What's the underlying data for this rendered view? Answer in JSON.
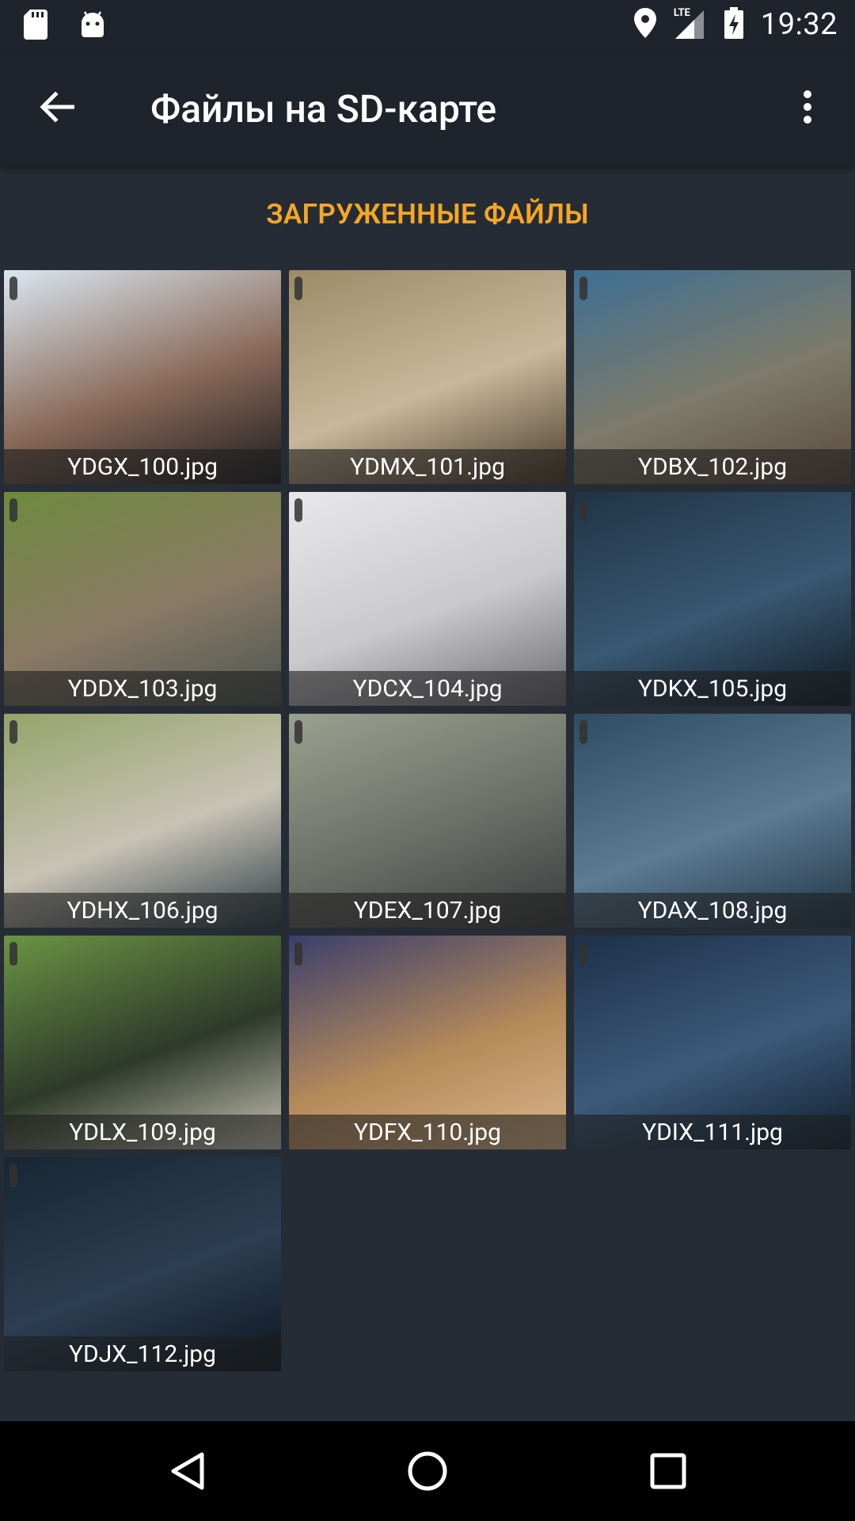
{
  "status_bar": {
    "time": "19:32",
    "network": "LTE",
    "icons": [
      "sd-card-icon",
      "android-icon",
      "location-icon",
      "signal-icon",
      "battery-charging-icon"
    ]
  },
  "app_bar": {
    "title": "Файлы на SD-карте",
    "back_icon": "arrow-back-icon",
    "menu_icon": "more-vert-icon"
  },
  "section": {
    "header": "ЗАГРУЖЕННЫЕ ФАЙЛЫ"
  },
  "files": [
    {
      "name": "YDGX_100.jpg",
      "colors": [
        "#d9e6f2",
        "#8a6a58",
        "#1b1b1f"
      ]
    },
    {
      "name": "YDMX_101.jpg",
      "colors": [
        "#9c8a68",
        "#c8b79a",
        "#4b3b2b"
      ]
    },
    {
      "name": "YDBX_102.jpg",
      "colors": [
        "#3e6f93",
        "#7e7b6a",
        "#5a4b3a"
      ]
    },
    {
      "name": "YDDX_103.jpg",
      "colors": [
        "#6e8a3e",
        "#8a7a65",
        "#4c5552"
      ]
    },
    {
      "name": "YDCX_104.jpg",
      "colors": [
        "#e8e8ea",
        "#c9c9cc",
        "#6a6a6f"
      ]
    },
    {
      "name": "YDKX_105.jpg",
      "colors": [
        "#1f3446",
        "#3a5872",
        "#0e1a24"
      ]
    },
    {
      "name": "YDHX_106.jpg",
      "colors": [
        "#93a46a",
        "#c8c2b4",
        "#2d3e48"
      ]
    },
    {
      "name": "YDEX_107.jpg",
      "colors": [
        "#9aa08f",
        "#6b6e67",
        "#3a3b3e"
      ]
    },
    {
      "name": "YDAX_108.jpg",
      "colors": [
        "#2f4c63",
        "#5d7b93",
        "#203445"
      ]
    },
    {
      "name": "YDLX_109.jpg",
      "colors": [
        "#6a9444",
        "#2e3a2a",
        "#c9c4b6"
      ]
    },
    {
      "name": "YDFX_110.jpg",
      "colors": [
        "#3b3f6c",
        "#b58a5a",
        "#d9b58b"
      ]
    },
    {
      "name": "YDIX_111.jpg",
      "colors": [
        "#1d3149",
        "#3d5a7a",
        "#10202f"
      ]
    },
    {
      "name": "YDJX_112.jpg",
      "colors": [
        "#182634",
        "#2c3e52",
        "#0c1520"
      ]
    }
  ],
  "nav_bar": {
    "back_icon": "nav-back-triangle-icon",
    "home_icon": "nav-home-circle-icon",
    "recents_icon": "nav-recents-square-icon"
  },
  "theme": {
    "background": "#262c35",
    "bar": "#1f242c",
    "accent": "#f5a623"
  }
}
